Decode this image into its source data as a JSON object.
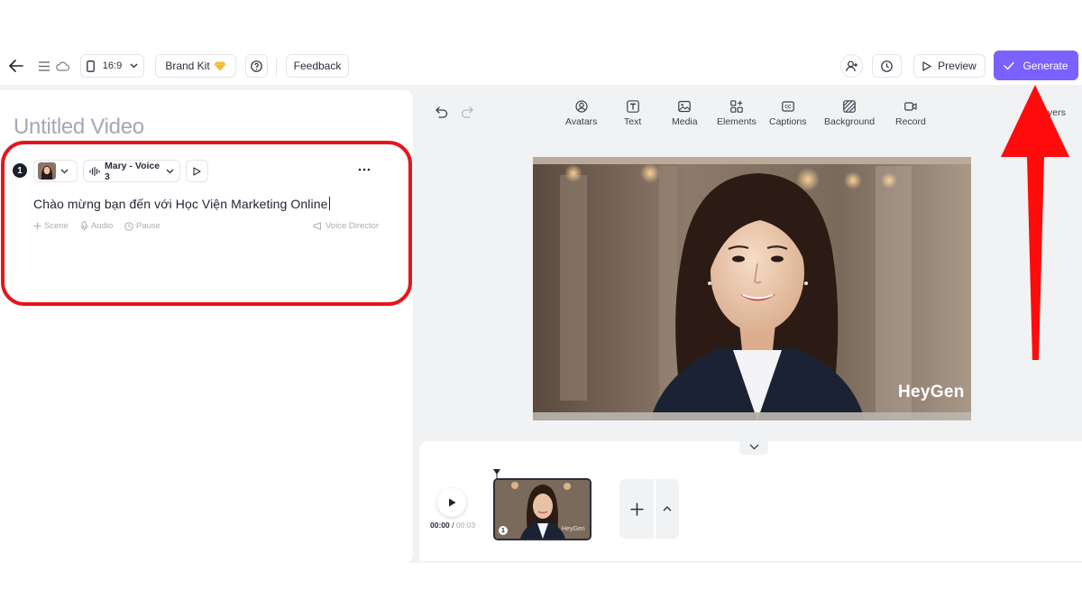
{
  "topbar": {
    "aspect_ratio": "16:9",
    "brand_kit_label": "Brand Kit",
    "feedback_label": "Feedback",
    "preview_label": "Preview",
    "generate_label": "Generate"
  },
  "editor": {
    "title": "Untitled Video",
    "scene": {
      "number": "1",
      "voice_label": "Mary - Voice 3",
      "script_text": "Chào mừng bạn đến với Học Viện Marketing Online",
      "actions": {
        "scene": "Scene",
        "audio": "Audio",
        "pause": "Pause",
        "voice_director": "Voice Director"
      }
    }
  },
  "toolbar": {
    "items": [
      {
        "label": "Avatars",
        "icon": "avatar-icon"
      },
      {
        "label": "Text",
        "icon": "text-icon"
      },
      {
        "label": "Media",
        "icon": "image-icon"
      },
      {
        "label": "Elements",
        "icon": "elements-icon"
      },
      {
        "label": "Captions",
        "icon": "captions-icon"
      },
      {
        "label": "Background",
        "icon": "background-icon"
      },
      {
        "label": "Record",
        "icon": "camera-icon"
      }
    ],
    "layers_label": "yers"
  },
  "preview": {
    "watermark": "HeyGen"
  },
  "timeline": {
    "current_time": "00:00",
    "separator": " / ",
    "duration": "00:03",
    "scene_badge": "1",
    "thumb_watermark": "HeyGen"
  },
  "colors": {
    "generate_bg": "#7b61ff",
    "annotation_red": "#e8141b"
  }
}
